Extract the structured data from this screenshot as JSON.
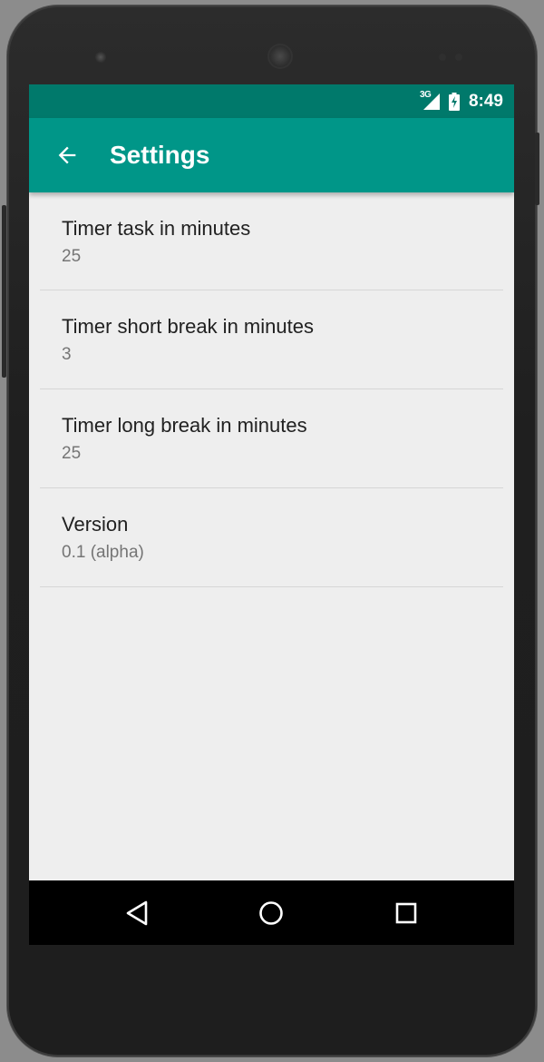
{
  "status_bar": {
    "network_type": "3G",
    "time": "8:49"
  },
  "app_bar": {
    "title": "Settings",
    "back_icon": "arrow-back-icon"
  },
  "preferences": [
    {
      "title": "Timer task in minutes",
      "summary": "25"
    },
    {
      "title": "Timer short break in minutes",
      "summary": "3"
    },
    {
      "title": "Timer long break in minutes",
      "summary": "25"
    },
    {
      "title": "Version",
      "summary": "0.1 (alpha)"
    }
  ],
  "nav_bar": {
    "back_icon": "nav-back-triangle-icon",
    "home_icon": "nav-home-circle-icon",
    "recents_icon": "nav-recents-square-icon"
  },
  "colors": {
    "status_bar": "#00796b",
    "app_bar": "#009688",
    "background": "#eeeeee",
    "primary_text": "#212121",
    "secondary_text": "#757575"
  }
}
